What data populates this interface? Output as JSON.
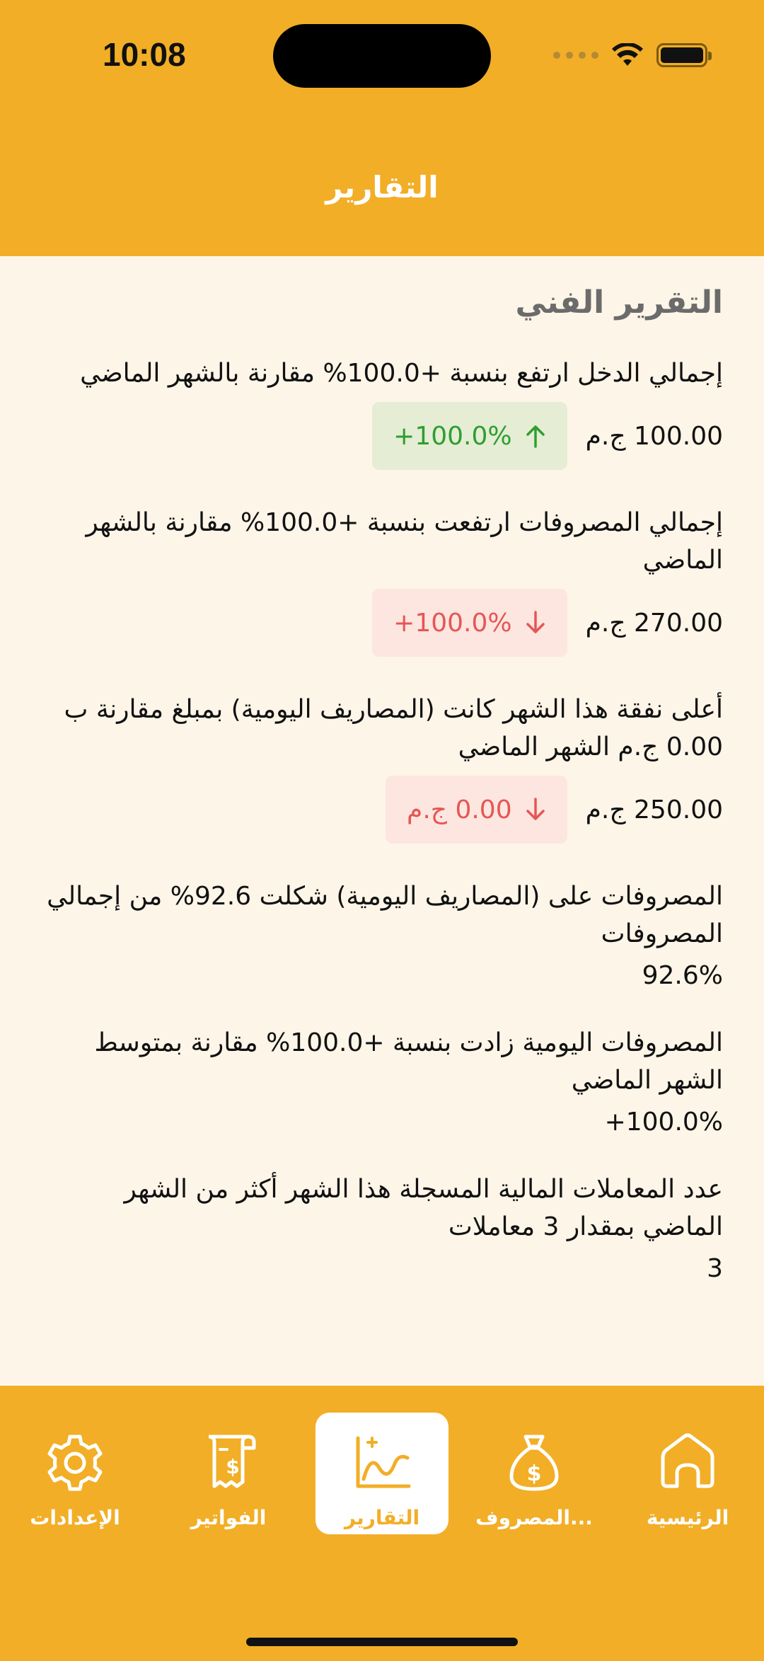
{
  "status": {
    "time": "10:08"
  },
  "header": {
    "title": "التقارير"
  },
  "section": {
    "title": "التقرير الفني"
  },
  "reports": [
    {
      "text": "إجمالي الدخل ارتفع بنسبة +100.0% مقارنة بالشهر الماضي",
      "amount": "100.00 ج.م",
      "badge": "+100.0%",
      "badge_dir": "up"
    },
    {
      "text": "إجمالي المصروفات ارتفعت بنسبة +100.0% مقارنة بالشهر الماضي",
      "amount": "270.00 ج.م",
      "badge": "+100.0%",
      "badge_dir": "down"
    },
    {
      "text": "أعلى نفقة هذا الشهر كانت (المصاريف اليومية) بمبلغ مقارنة ب 0.00 ج.م الشهر الماضي",
      "amount": "250.00 ج.م",
      "badge": "0.00 ج.م",
      "badge_dir": "down"
    },
    {
      "text": "المصروفات على (المصاريف اليومية) شكلت 92.6% من إجمالي المصروفات",
      "value": "92.6%"
    },
    {
      "text": "المصروفات اليومية زادت بنسبة +100.0% مقارنة بمتوسط الشهر الماضي",
      "value": "+100.0%"
    },
    {
      "text": "عدد المعاملات المالية المسجلة هذا الشهر أكثر من الشهر الماضي بمقدار 3 معاملات",
      "value": "3"
    }
  ],
  "tabs": [
    {
      "label": "الرئيسية",
      "icon": "home-icon"
    },
    {
      "label": "المصروف...",
      "icon": "money-bag-icon"
    },
    {
      "label": "التقارير",
      "icon": "chart-icon",
      "active": true
    },
    {
      "label": "الفواتير",
      "icon": "receipt-icon"
    },
    {
      "label": "الإعدادات",
      "icon": "gear-icon"
    }
  ],
  "colors": {
    "accent": "#F2AE26",
    "background": "#FDF5E8",
    "up": "#2F9E2F",
    "down": "#E55656"
  }
}
